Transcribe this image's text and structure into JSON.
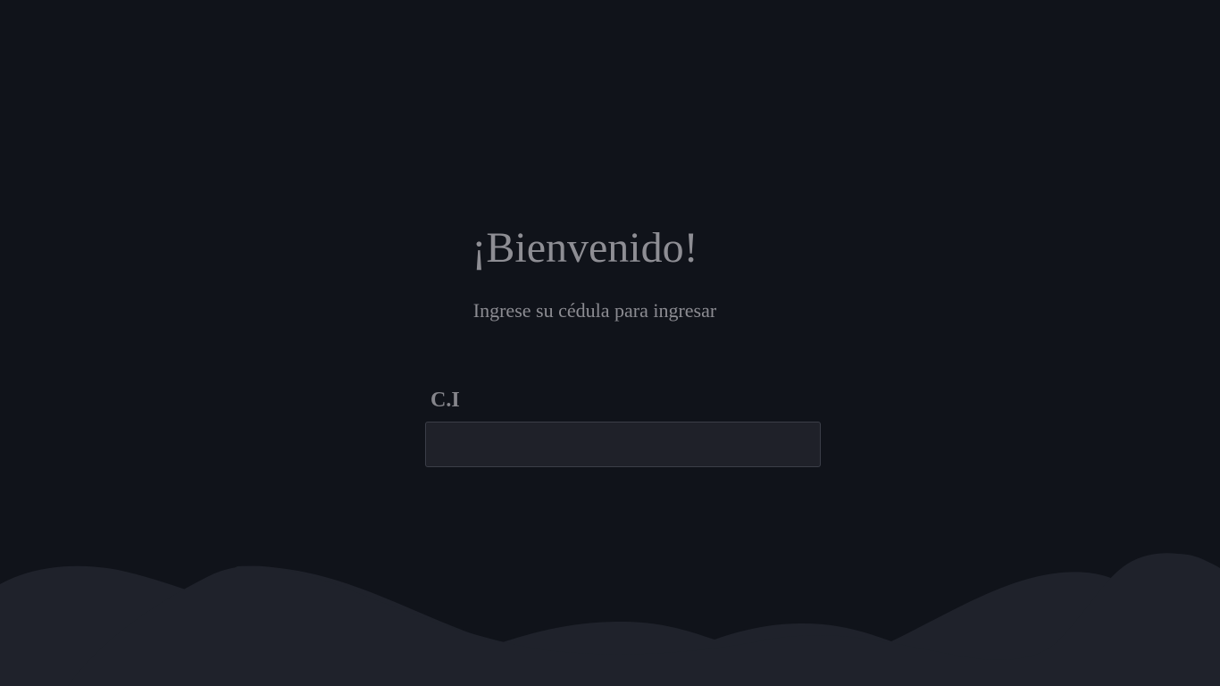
{
  "login": {
    "title": "¡Bienvenido!",
    "subtitle": "Ingrese su cédula para ingresar",
    "ci_label": "C.I",
    "ci_value": "",
    "ci_placeholder": ""
  },
  "colors": {
    "background": "#10131a",
    "wave": "#1f222b",
    "input_background": "#1f2129",
    "input_border": "#3b3e48",
    "text": "#8e8e94"
  }
}
